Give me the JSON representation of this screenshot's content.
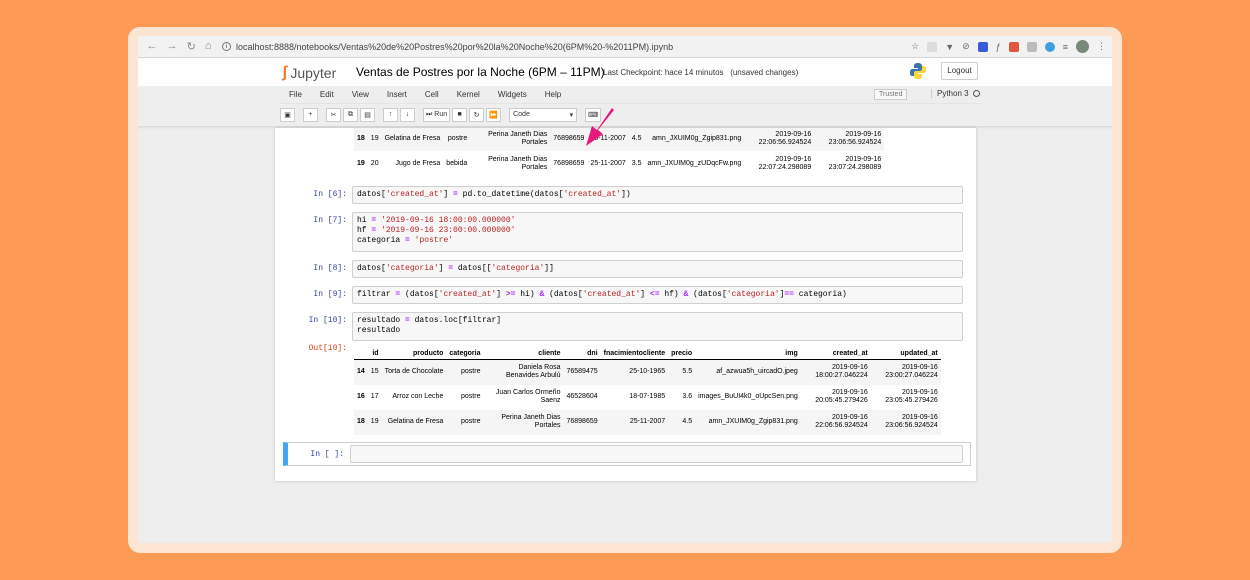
{
  "browser": {
    "url": "localhost:8888/notebooks/Ventas%20de%20Postres%20por%20la%20Noche%20(6PM%20-%2011PM).ipynb"
  },
  "header": {
    "logo_text": "Jupyter",
    "notebook_title": "Ventas de Postres por la Noche (6PM – 11PM)",
    "checkpoint": "Last Checkpoint: hace 14 minutos",
    "unsaved": "(unsaved changes)",
    "logout": "Logout"
  },
  "menu": [
    "File",
    "Edit",
    "View",
    "Insert",
    "Cell",
    "Kernel",
    "Widgets",
    "Help"
  ],
  "status": {
    "trusted": "Trusted",
    "kernel": "Python 3"
  },
  "toolbar": {
    "run_label": "Run",
    "cell_type": "Code"
  },
  "top_table": {
    "rows": [
      [
        "18",
        "19",
        "Gelatina de Fresa",
        "postre",
        "Perina Janeth Dias Portales",
        "76898659",
        "25-11-2007",
        "4.5",
        "amn_JXUIM0g_Zgip831.png",
        "2019-09-16 22:06:56.924524",
        "2019-09-16 23:06:56.924524"
      ],
      [
        "19",
        "20",
        "Jugo de Fresa",
        "bebida",
        "Perina Janeth Dias Portales",
        "76898659",
        "25-11-2007",
        "3.5",
        "amn_JXUIM0g_zUDqcFw.png",
        "2019-09-16 22:07:24.298089",
        "2019-09-16 23:07:24.298089"
      ]
    ]
  },
  "cells": {
    "c6": {
      "prompt": "In [6]:"
    },
    "c7": {
      "prompt": "In [7]:"
    },
    "c8": {
      "prompt": "In [8]:"
    },
    "c9": {
      "prompt": "In [9]:"
    },
    "c10": {
      "prompt": "In [10]:",
      "out_prompt": "Out[10]:"
    },
    "empty": {
      "prompt": "In [ ]:"
    }
  },
  "result_table": {
    "columns": [
      "",
      "id",
      "producto",
      "categoria",
      "cliente",
      "dni",
      "fnacimientocliente",
      "precio",
      "img",
      "created_at",
      "updated_at"
    ],
    "rows": [
      [
        "14",
        "15",
        "Torta de Chocolate",
        "postre",
        "Daniela Rosa Benavides Arbulú",
        "76589475",
        "25-10-1965",
        "5.5",
        "af_azwua5h_uircadO.jpeg",
        "2019-09-16 18:00:27.046224",
        "2019-09-16 23:00:27.046224"
      ],
      [
        "16",
        "17",
        "Arroz con Leche",
        "postre",
        "Juan Carlos Ormeño Saenz",
        "46528604",
        "18-07-1985",
        "3.6",
        "images_BuUI4k0_oUpcSen.png",
        "2019-09-16 20:05:45.279426",
        "2019-09-16 23:05:45.279426"
      ],
      [
        "18",
        "19",
        "Gelatina de Fresa",
        "postre",
        "Perina Janeth Dias Portales",
        "76898659",
        "25-11-2007",
        "4.5",
        "amn_JXUIM0g_Zgip831.png",
        "2019-09-16 22:06:56.924524",
        "2019-09-16 23:06:56.924524"
      ]
    ]
  },
  "colors": {
    "background": "#fd9a56",
    "arrow": "#e8197d",
    "selected_cell": "#42a5f5"
  }
}
